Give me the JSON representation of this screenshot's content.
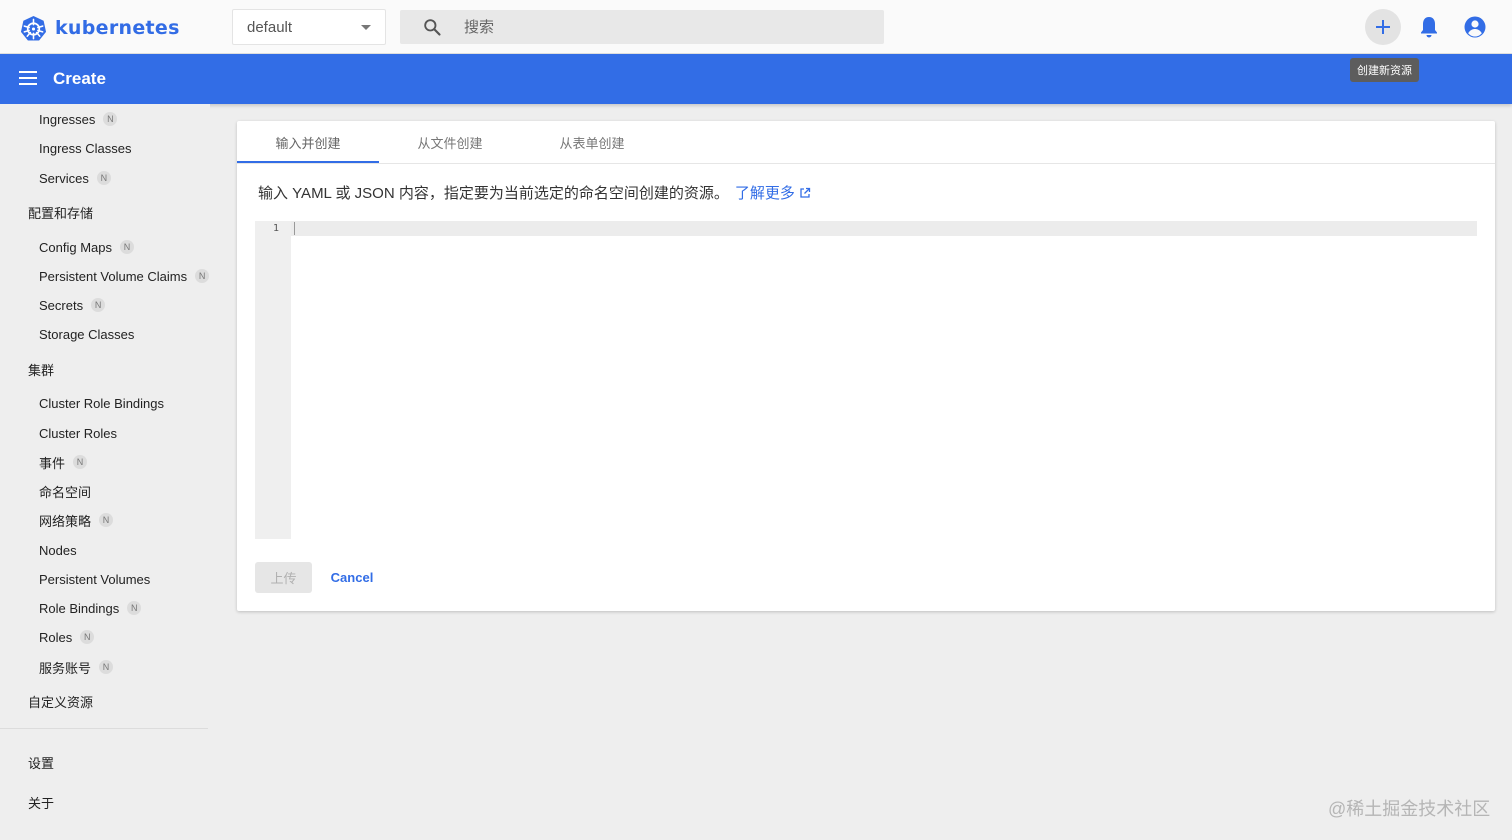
{
  "topbar": {
    "logo_text": "kubernetes",
    "namespace": "default",
    "search_placeholder": "搜索",
    "create_tooltip": "创建新资源"
  },
  "actionbar": {
    "title": "Create"
  },
  "sidebar": {
    "items": [
      {
        "label": "Ingresses",
        "badge": "N"
      },
      {
        "label": "Ingress Classes",
        "badge": ""
      },
      {
        "label": "Services",
        "badge": "N"
      },
      {
        "label": "Config Maps",
        "badge": "N"
      },
      {
        "label": "Persistent Volume Claims",
        "badge": "N"
      },
      {
        "label": "Secrets",
        "badge": "N"
      },
      {
        "label": "Storage Classes",
        "badge": ""
      },
      {
        "label": "Cluster Role Bindings",
        "badge": ""
      },
      {
        "label": "Cluster Roles",
        "badge": ""
      },
      {
        "label": "事件",
        "badge": "N"
      },
      {
        "label": "命名空间",
        "badge": ""
      },
      {
        "label": "网络策略",
        "badge": "N"
      },
      {
        "label": "Nodes",
        "badge": ""
      },
      {
        "label": "Persistent Volumes",
        "badge": ""
      },
      {
        "label": "Role Bindings",
        "badge": "N"
      },
      {
        "label": "Roles",
        "badge": "N"
      },
      {
        "label": "服务账号",
        "badge": "N"
      }
    ],
    "headers": {
      "config_storage": "配置和存储",
      "cluster": "集群",
      "crd": "自定义资源",
      "settings": "设置",
      "about": "关于"
    }
  },
  "main": {
    "tabs": [
      {
        "label": "输入并创建"
      },
      {
        "label": "从文件创建"
      },
      {
        "label": "从表单创建"
      }
    ],
    "description": "输入 YAML 或 JSON 内容，指定要为当前选定的命名空间创建的资源。",
    "learn_more": "了解更多",
    "editor_line": "1",
    "upload_label": "上传",
    "cancel_label": "Cancel"
  },
  "watermark": "@稀土掘金技术社区",
  "colors": {
    "brand": "#326ce5",
    "actionbar": "#326de6"
  }
}
